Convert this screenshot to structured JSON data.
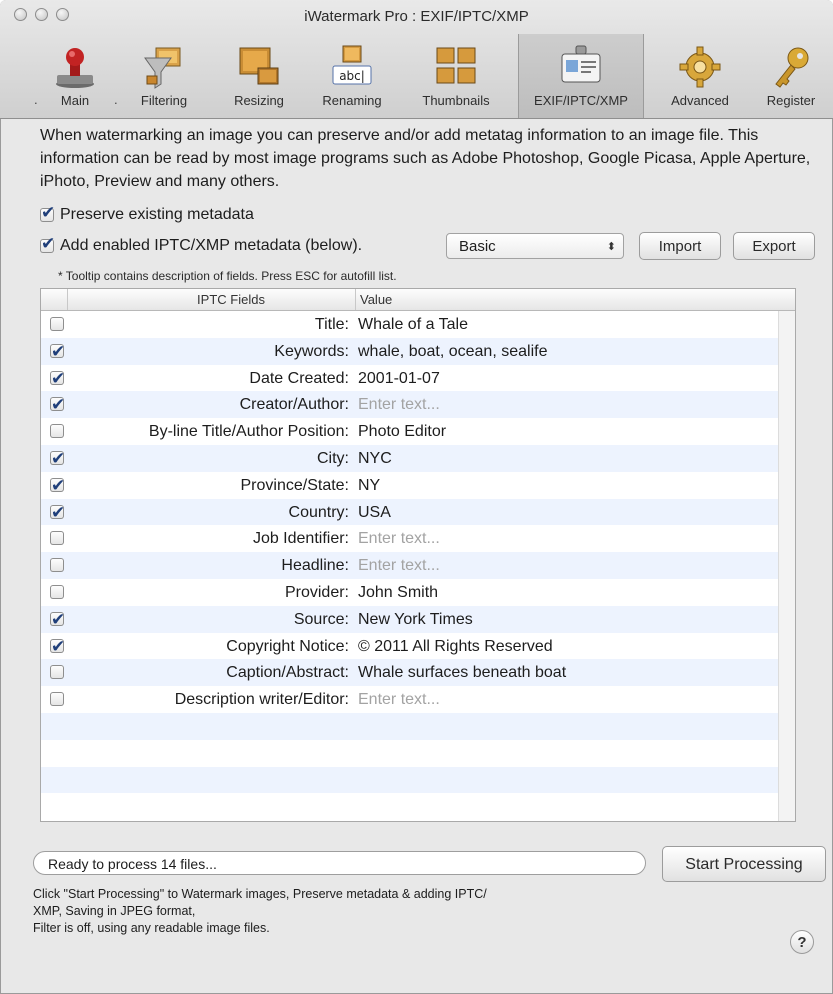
{
  "window": {
    "title": "iWatermark Pro : EXIF/IPTC/XMP"
  },
  "toolbar": {
    "items": [
      {
        "label": "Main",
        "icon": "stamp-icon"
      },
      {
        "label": "Filtering",
        "icon": "funnel-icon"
      },
      {
        "label": "Resizing",
        "icon": "resize-images-icon"
      },
      {
        "label": "Renaming",
        "icon": "rename-text-icon"
      },
      {
        "label": "Thumbnails",
        "icon": "thumbnails-grid-icon"
      },
      {
        "label": "EXIF/IPTC/XMP",
        "icon": "id-card-icon",
        "selected": true
      },
      {
        "label": "Advanced",
        "icon": "gear-icon"
      },
      {
        "label": "Register",
        "icon": "key-icon"
      }
    ],
    "dot": "."
  },
  "intro": "When watermarking an image you can preserve and/or add metatag information to an image file.  This information can be read by most image programs such as Adobe Photoshop, Google Picasa, Apple Aperture, iPhoto, Preview and many others.",
  "options": {
    "preserve_label": "Preserve existing metadata",
    "preserve_checked": true,
    "add_label": "Add enabled IPTC/XMP metadata (below).",
    "add_checked": true,
    "preset_value": "Basic",
    "import_label": "Import",
    "export_label": "Export"
  },
  "hint": "* Tooltip contains description of fields. Press ESC for autofill list.",
  "table": {
    "columns": [
      "IPTC Fields",
      "Value"
    ],
    "rows": [
      {
        "checked": false,
        "field": "Title:",
        "value": "Whale of a Tale",
        "placeholder": false
      },
      {
        "checked": true,
        "field": "Keywords:",
        "value": "whale, boat, ocean, sealife",
        "placeholder": false
      },
      {
        "checked": true,
        "field": "Date Created:",
        "value": "2001-01-07",
        "placeholder": false
      },
      {
        "checked": true,
        "field": "Creator/Author:",
        "value": "Enter text...",
        "placeholder": true
      },
      {
        "checked": false,
        "field": "By-line Title/Author Position:",
        "value": "Photo Editor",
        "placeholder": false
      },
      {
        "checked": true,
        "field": "City:",
        "value": "NYC",
        "placeholder": false
      },
      {
        "checked": true,
        "field": "Province/State:",
        "value": "NY",
        "placeholder": false
      },
      {
        "checked": true,
        "field": "Country:",
        "value": "USA",
        "placeholder": false
      },
      {
        "checked": false,
        "field": "Job Identifier:",
        "value": "Enter text...",
        "placeholder": true
      },
      {
        "checked": false,
        "field": "Headline:",
        "value": "Enter text...",
        "placeholder": true
      },
      {
        "checked": false,
        "field": "Provider:",
        "value": "John Smith",
        "placeholder": false
      },
      {
        "checked": true,
        "field": "Source:",
        "value": "New York Times",
        "placeholder": false
      },
      {
        "checked": true,
        "field": "Copyright Notice:",
        "value": "© 2011 All Rights Reserved",
        "placeholder": false
      },
      {
        "checked": false,
        "field": "Caption/Abstract:",
        "value": "Whale surfaces beneath boat",
        "placeholder": false
      },
      {
        "checked": false,
        "field": "Description writer/Editor:",
        "value": "Enter text...",
        "placeholder": true
      }
    ],
    "empty_rows": 4
  },
  "status": {
    "text": "Ready to process 14 files...",
    "start_label": "Start Processing",
    "footnote": [
      "Click \"Start Processing\" to Watermark images, Preserve metadata & adding IPTC/",
      "XMP, Saving in JPEG format,",
      "Filter is off, using any readable image files."
    ],
    "help_label": "?"
  }
}
